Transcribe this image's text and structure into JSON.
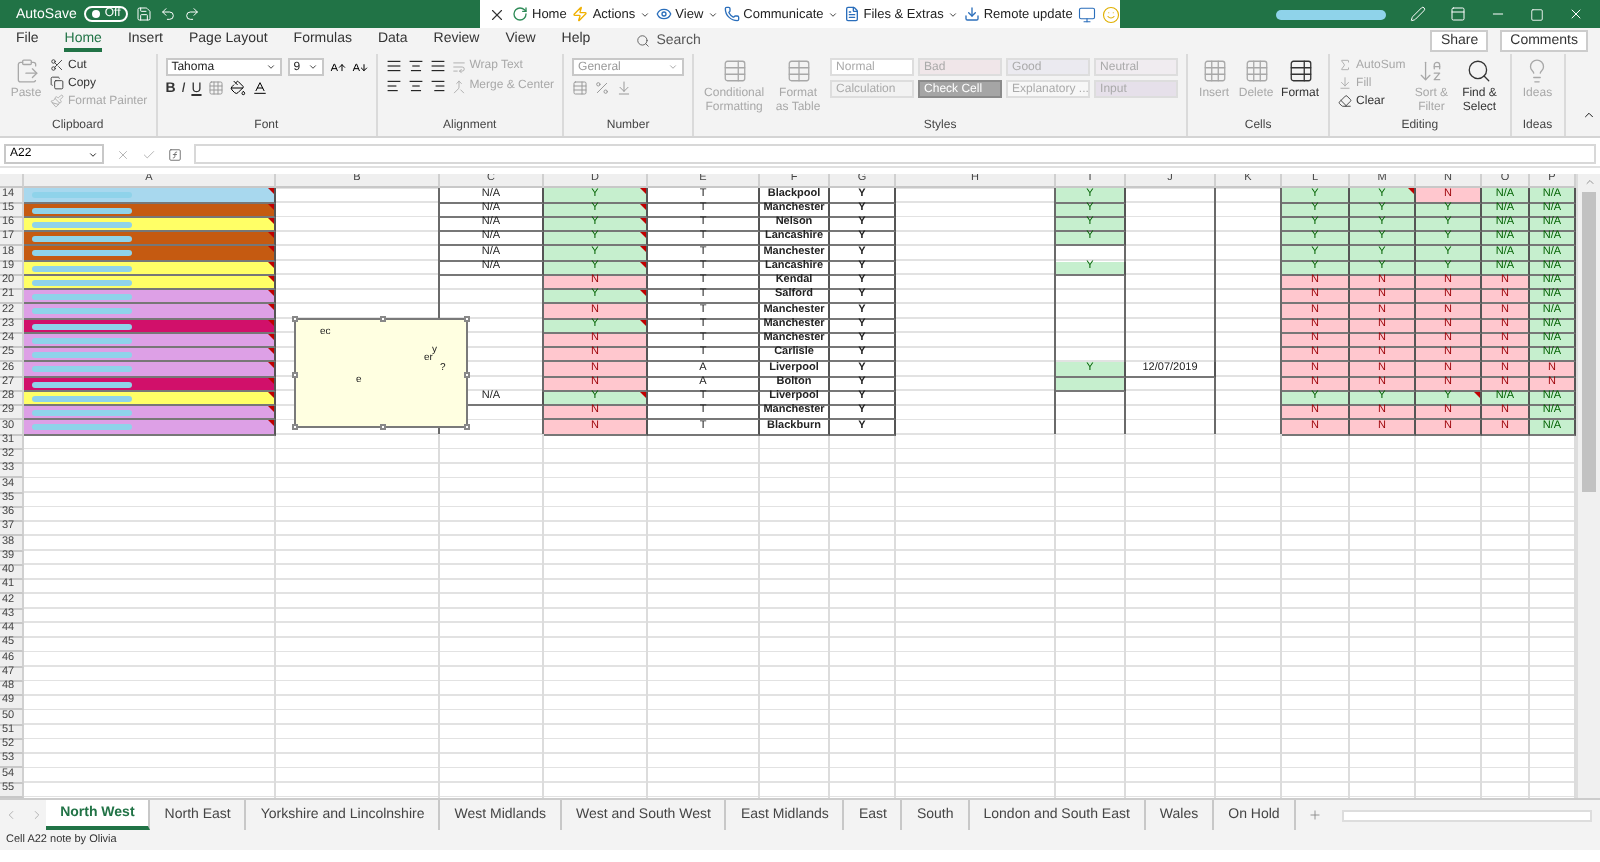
{
  "title_bar": {
    "autosave_label": "AutoSave",
    "autosave_toggle": {
      "label": "Off",
      "on": false
    },
    "addin_items": [
      {
        "label": "Home",
        "dropdown": false
      },
      {
        "label": "Actions",
        "dropdown": true
      },
      {
        "label": "View",
        "dropdown": true
      },
      {
        "label": "Communicate",
        "dropdown": true
      },
      {
        "label": "Files & Extras",
        "dropdown": true
      },
      {
        "label": "Remote update",
        "dropdown": false
      }
    ]
  },
  "ribbon_tabs": [
    {
      "label": "File",
      "selected": false
    },
    {
      "label": "Home",
      "selected": true
    },
    {
      "label": "Insert",
      "selected": false
    },
    {
      "label": "Page Layout",
      "selected": false
    },
    {
      "label": "Formulas",
      "selected": false
    },
    {
      "label": "Data",
      "selected": false
    },
    {
      "label": "Review",
      "selected": false
    },
    {
      "label": "View",
      "selected": false
    },
    {
      "label": "Help",
      "selected": false
    }
  ],
  "search": {
    "placeholder": "Search"
  },
  "share_button": "Share",
  "comments_button": "Comments",
  "ribbon_groups": [
    {
      "kind": "clipboard",
      "name": "Clipboard",
      "buttons": [
        {
          "label": "Paste",
          "disabled": true
        },
        {
          "label": "Cut",
          "disabled": false
        },
        {
          "label": "Copy",
          "disabled": false
        },
        {
          "label": "Format Painter",
          "disabled": true
        }
      ]
    },
    {
      "kind": "font",
      "name": "Font",
      "font": "Tahoma",
      "size": "9",
      "buttons": [
        {
          "label": "B",
          "disabled": false
        },
        {
          "label": "I",
          "disabled": false
        },
        {
          "label": "U",
          "disabled": false
        }
      ]
    },
    {
      "kind": "alignment",
      "name": "Alignment",
      "buttons": [
        {
          "label": "Wrap Text",
          "disabled": true
        },
        {
          "label": "Merge & Center",
          "disabled": true
        }
      ]
    },
    {
      "kind": "number",
      "name": "Number",
      "format": "General"
    },
    {
      "kind": "styles",
      "name": "Styles",
      "buttons": [
        {
          "label": "Conditional Formatting",
          "disabled": true
        },
        {
          "label": "Format as Table",
          "disabled": true
        }
      ],
      "styles": [
        {
          "label": "Normal",
          "kind": "normal"
        },
        {
          "label": "Bad",
          "kind": "bad"
        },
        {
          "label": "Good",
          "kind": "good"
        },
        {
          "label": "Neutral",
          "kind": "neutral"
        },
        {
          "label": "Calculation",
          "kind": "calculation"
        },
        {
          "label": "Check Cell",
          "kind": "check"
        },
        {
          "label": "Explanatory ...",
          "kind": "explanatory"
        },
        {
          "label": "Input",
          "kind": "input"
        }
      ]
    },
    {
      "kind": "cells",
      "name": "Cells",
      "buttons": [
        {
          "label": "Insert",
          "disabled": true
        },
        {
          "label": "Delete",
          "disabled": true
        },
        {
          "label": "Format",
          "disabled": false
        }
      ]
    },
    {
      "kind": "editing",
      "name": "Editing",
      "buttons": [
        {
          "label": "AutoSum",
          "disabled": true
        },
        {
          "label": "Fill",
          "disabled": true
        },
        {
          "label": "Clear",
          "disabled": false
        },
        {
          "label": "Sort & Filter",
          "disabled": true
        },
        {
          "label": "Find & Select",
          "disabled": false
        }
      ]
    },
    {
      "kind": "ideas",
      "name": "Ideas",
      "buttons": [
        {
          "label": "Ideas",
          "disabled": true
        }
      ]
    }
  ],
  "name_box": "A22",
  "grid": {
    "columns": [
      "A",
      "B",
      "C",
      "D",
      "E",
      "F",
      "G",
      "H",
      "I",
      "J",
      "K",
      "L",
      "M",
      "N",
      "O",
      "P"
    ],
    "rows": [
      {
        "number": "14",
        "cells": {
          "A": {
            "color": "#a8d8ee",
            "note": true
          },
          "C": {
            "text": "N/A"
          },
          "D": {
            "text": "Y",
            "positive": true,
            "note": true
          },
          "E": {
            "text": "T"
          },
          "F": {
            "text": "Blackpool"
          },
          "G": {
            "text": "Y"
          },
          "I": {
            "text": "Y",
            "positive": true
          },
          "L": {
            "text": "Y",
            "positive": true
          },
          "M": {
            "text": "Y",
            "positive": true,
            "note": true
          },
          "N": {
            "text": "N",
            "positive": false
          },
          "O": {
            "text": "N/A",
            "positive": true
          },
          "P": {
            "text": "N/A",
            "positive": true
          }
        }
      },
      {
        "number": "15",
        "cells": {
          "A": {
            "color": "#c55a11",
            "note": true
          },
          "C": {
            "text": "N/A"
          },
          "D": {
            "text": "Y",
            "positive": true,
            "note": true
          },
          "E": {
            "text": "T"
          },
          "F": {
            "text": "Manchester"
          },
          "G": {
            "text": "Y"
          },
          "I": {
            "text": "Y",
            "positive": true
          },
          "L": {
            "text": "Y",
            "positive": true
          },
          "M": {
            "text": "Y",
            "positive": true
          },
          "N": {
            "text": "Y",
            "positive": true
          },
          "O": {
            "text": "N/A",
            "positive": true
          },
          "P": {
            "text": "N/A",
            "positive": true
          }
        }
      },
      {
        "number": "16",
        "cells": {
          "A": {
            "color": "#ffff66",
            "note": true
          },
          "C": {
            "text": "N/A"
          },
          "D": {
            "text": "Y",
            "positive": true,
            "note": true
          },
          "E": {
            "text": "T"
          },
          "F": {
            "text": "Nelson"
          },
          "G": {
            "text": "Y"
          },
          "I": {
            "text": "Y",
            "positive": true
          },
          "L": {
            "text": "Y",
            "positive": true
          },
          "M": {
            "text": "Y",
            "positive": true
          },
          "N": {
            "text": "Y",
            "positive": true
          },
          "O": {
            "text": "N/A",
            "positive": true
          },
          "P": {
            "text": "N/A",
            "positive": true
          }
        }
      },
      {
        "number": "17",
        "cells": {
          "A": {
            "color": "#c55a11",
            "note": true
          },
          "C": {
            "text": "N/A"
          },
          "D": {
            "text": "Y",
            "positive": true,
            "note": true
          },
          "E": {
            "text": "T"
          },
          "F": {
            "text": "Lancashire"
          },
          "G": {
            "text": "Y"
          },
          "I": {
            "text": "Y",
            "positive": true
          },
          "L": {
            "text": "Y",
            "positive": true
          },
          "M": {
            "text": "Y",
            "positive": true
          },
          "N": {
            "text": "Y",
            "positive": true
          },
          "O": {
            "text": "N/A",
            "positive": true
          },
          "P": {
            "text": "N/A",
            "positive": true
          }
        }
      },
      {
        "number": "18",
        "cells": {
          "A": {
            "color": "#c55a11",
            "note": true
          },
          "C": {
            "text": "N/A"
          },
          "D": {
            "text": "Y",
            "positive": true,
            "note": true
          },
          "E": {
            "text": "T"
          },
          "F": {
            "text": "Manchester"
          },
          "G": {
            "text": "Y"
          },
          "L": {
            "text": "Y",
            "positive": true
          },
          "M": {
            "text": "Y",
            "positive": true
          },
          "N": {
            "text": "Y",
            "positive": true
          },
          "O": {
            "text": "N/A",
            "positive": true
          },
          "P": {
            "text": "N/A",
            "positive": true
          }
        }
      },
      {
        "number": "19",
        "cells": {
          "A": {
            "color": "#ffff66",
            "note": true
          },
          "C": {
            "text": "N/A"
          },
          "D": {
            "text": "Y",
            "positive": true,
            "note": true
          },
          "E": {
            "text": "T"
          },
          "F": {
            "text": "Lancashire"
          },
          "G": {
            "text": "Y"
          },
          "I": {
            "text": "Y",
            "positive": true
          },
          "L": {
            "text": "Y",
            "positive": true
          },
          "M": {
            "text": "Y",
            "positive": true
          },
          "N": {
            "text": "Y",
            "positive": true
          },
          "O": {
            "text": "N/A",
            "positive": true
          },
          "P": {
            "text": "N/A",
            "positive": true
          }
        }
      },
      {
        "number": "20",
        "cells": {
          "A": {
            "color": "#ffff66",
            "note": true
          },
          "D": {
            "text": "N",
            "positive": false
          },
          "E": {
            "text": "T"
          },
          "F": {
            "text": "Kendal"
          },
          "G": {
            "text": "Y"
          },
          "L": {
            "text": "N",
            "positive": false
          },
          "M": {
            "text": "N",
            "positive": false
          },
          "N": {
            "text": "N",
            "positive": false
          },
          "O": {
            "text": "N",
            "positive": false
          },
          "P": {
            "text": "N/A",
            "positive": true
          }
        }
      },
      {
        "number": "21",
        "cells": {
          "A": {
            "color": "#dda0e6",
            "note": true
          },
          "D": {
            "text": "Y",
            "positive": true,
            "note": true
          },
          "E": {
            "text": "T"
          },
          "F": {
            "text": "Salford"
          },
          "G": {
            "text": "Y"
          },
          "L": {
            "text": "N",
            "positive": false
          },
          "M": {
            "text": "N",
            "positive": false
          },
          "N": {
            "text": "N",
            "positive": false
          },
          "O": {
            "text": "N",
            "positive": false
          },
          "P": {
            "text": "N/A",
            "positive": true
          }
        }
      },
      {
        "number": "22",
        "cells": {
          "A": {
            "color": "#dda0e6",
            "note": true
          },
          "D": {
            "text": "N",
            "positive": false
          },
          "E": {
            "text": "T"
          },
          "F": {
            "text": "Manchester"
          },
          "G": {
            "text": "Y"
          },
          "L": {
            "text": "N",
            "positive": false
          },
          "M": {
            "text": "N",
            "positive": false
          },
          "N": {
            "text": "N",
            "positive": false
          },
          "O": {
            "text": "N",
            "positive": false
          },
          "P": {
            "text": "N/A",
            "positive": true
          }
        }
      },
      {
        "number": "23",
        "cells": {
          "A": {
            "color": "#d1106a",
            "note": true
          },
          "D": {
            "text": "Y",
            "positive": true,
            "note": true
          },
          "E": {
            "text": "T"
          },
          "F": {
            "text": "Manchester"
          },
          "G": {
            "text": "Y"
          },
          "L": {
            "text": "N",
            "positive": false
          },
          "M": {
            "text": "N",
            "positive": false
          },
          "N": {
            "text": "N",
            "positive": false
          },
          "O": {
            "text": "N",
            "positive": false
          },
          "P": {
            "text": "N/A",
            "positive": true
          }
        }
      },
      {
        "number": "24",
        "cells": {
          "A": {
            "color": "#dda0e6",
            "note": true
          },
          "D": {
            "text": "N",
            "positive": false
          },
          "E": {
            "text": "T"
          },
          "F": {
            "text": "Manchester"
          },
          "G": {
            "text": "Y"
          },
          "L": {
            "text": "N",
            "positive": false
          },
          "M": {
            "text": "N",
            "positive": false
          },
          "N": {
            "text": "N",
            "positive": false
          },
          "O": {
            "text": "N",
            "positive": false
          },
          "P": {
            "text": "N/A",
            "positive": true
          }
        }
      },
      {
        "number": "25",
        "cells": {
          "A": {
            "color": "#dda0e6",
            "note": true
          },
          "D": {
            "text": "N",
            "positive": false
          },
          "E": {
            "text": "T"
          },
          "F": {
            "text": "Carlisle"
          },
          "G": {
            "text": "Y"
          },
          "L": {
            "text": "N",
            "positive": false
          },
          "M": {
            "text": "N",
            "positive": false
          },
          "N": {
            "text": "N",
            "positive": false
          },
          "O": {
            "text": "N",
            "positive": false
          },
          "P": {
            "text": "N/A",
            "positive": true
          }
        }
      },
      {
        "number": "26",
        "cells": {
          "A": {
            "color": "#dda0e6",
            "note": true
          },
          "D": {
            "text": "N",
            "positive": false
          },
          "E": {
            "text": "A"
          },
          "F": {
            "text": "Liverpool"
          },
          "G": {
            "text": "Y"
          },
          "I": {
            "text": "Y",
            "positive": true
          },
          "J": {
            "text": "12/07/2019"
          },
          "L": {
            "text": "N",
            "positive": false
          },
          "M": {
            "text": "N",
            "positive": false
          },
          "N": {
            "text": "N",
            "positive": false
          },
          "O": {
            "text": "N",
            "positive": false
          },
          "P": {
            "text": "N",
            "positive": false
          }
        }
      },
      {
        "number": "27",
        "cells": {
          "A": {
            "color": "#d1106a",
            "note": true
          },
          "D": {
            "text": "N",
            "positive": false
          },
          "E": {
            "text": "A"
          },
          "F": {
            "text": "Bolton"
          },
          "G": {
            "text": "Y"
          },
          "I": {
            "positive": true
          },
          "L": {
            "text": "N",
            "positive": false
          },
          "M": {
            "text": "N",
            "positive": false
          },
          "N": {
            "text": "N",
            "positive": false
          },
          "O": {
            "text": "N",
            "positive": false
          },
          "P": {
            "text": "N",
            "positive": false
          }
        }
      },
      {
        "number": "28",
        "cells": {
          "A": {
            "color": "#ffff66",
            "note": true
          },
          "C": {
            "text": "N/A"
          },
          "D": {
            "text": "Y",
            "positive": true,
            "note": true
          },
          "E": {
            "text": "T"
          },
          "F": {
            "text": "Liverpool"
          },
          "G": {
            "text": "Y"
          },
          "L": {
            "text": "Y",
            "positive": true
          },
          "M": {
            "text": "Y",
            "positive": true
          },
          "N": {
            "text": "Y",
            "positive": true,
            "note": true
          },
          "O": {
            "text": "N/A",
            "positive": true
          },
          "P": {
            "text": "N/A",
            "positive": true
          }
        }
      },
      {
        "number": "29",
        "cells": {
          "A": {
            "color": "#dda0e6",
            "note": true
          },
          "D": {
            "text": "N",
            "positive": false
          },
          "E": {
            "text": "T"
          },
          "F": {
            "text": "Manchester"
          },
          "G": {
            "text": "Y"
          },
          "L": {
            "text": "N",
            "positive": false
          },
          "M": {
            "text": "N",
            "positive": false
          },
          "N": {
            "text": "N",
            "positive": false
          },
          "O": {
            "text": "N",
            "positive": false
          },
          "P": {
            "text": "N/A",
            "positive": true
          }
        }
      },
      {
        "number": "30",
        "cells": {
          "A": {
            "color": "#dda0e6",
            "note": true
          },
          "D": {
            "text": "N",
            "positive": false
          },
          "E": {
            "text": "T"
          },
          "F": {
            "text": "Blackburn"
          },
          "G": {
            "text": "Y"
          },
          "L": {
            "text": "N",
            "positive": false
          },
          "M": {
            "text": "N",
            "positive": false
          },
          "N": {
            "text": "N",
            "positive": false
          },
          "O": {
            "text": "N",
            "positive": false
          },
          "P": {
            "text": "N/A",
            "positive": true
          }
        }
      },
      {
        "number": "31"
      },
      {
        "number": "32"
      },
      {
        "number": "33"
      },
      {
        "number": "34"
      },
      {
        "number": "35"
      },
      {
        "number": "36"
      },
      {
        "number": "37"
      },
      {
        "number": "38"
      },
      {
        "number": "39"
      },
      {
        "number": "40"
      },
      {
        "number": "41"
      },
      {
        "number": "42"
      },
      {
        "number": "43"
      },
      {
        "number": "44"
      },
      {
        "number": "45"
      },
      {
        "number": "46"
      },
      {
        "number": "47"
      },
      {
        "number": "48"
      },
      {
        "number": "49"
      },
      {
        "number": "50"
      },
      {
        "number": "51"
      },
      {
        "number": "52"
      },
      {
        "number": "53"
      },
      {
        "number": "54"
      },
      {
        "number": "55"
      }
    ]
  },
  "note_box": {
    "fragments": [
      "ec",
      "y",
      "er",
      "?",
      "e"
    ]
  },
  "sheet_tabs": [
    {
      "label": "North West",
      "selected": true
    },
    {
      "label": "North East",
      "selected": false
    },
    {
      "label": "Yorkshire and Lincolnshire",
      "selected": false
    },
    {
      "label": "West Midlands",
      "selected": false
    },
    {
      "label": "West and South West",
      "selected": false
    },
    {
      "label": "East Midlands",
      "selected": false
    },
    {
      "label": "East",
      "selected": false
    },
    {
      "label": "South",
      "selected": false
    },
    {
      "label": "London and South East",
      "selected": false
    },
    {
      "label": "Wales",
      "selected": false
    },
    {
      "label": "On Hold",
      "selected": false
    }
  ],
  "status_bar": {
    "message": "Cell A22 note by Olivia"
  }
}
